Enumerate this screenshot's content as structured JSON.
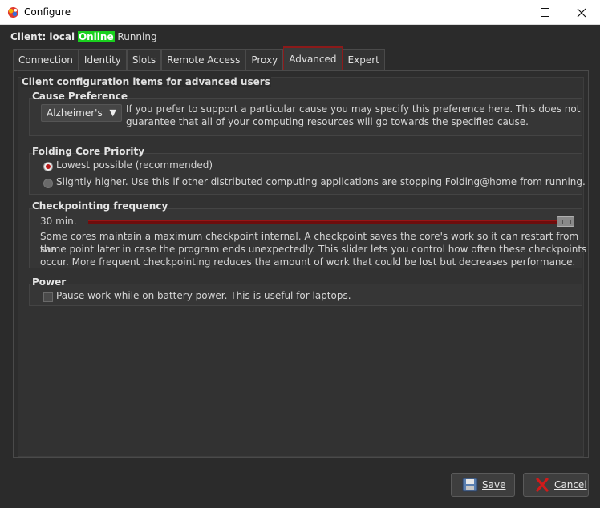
{
  "window": {
    "title": "Configure",
    "icons": {
      "app": "folding-at-home-logo-icon",
      "minimize": "minimize-icon",
      "maximize": "maximize-icon",
      "close": "close-icon"
    }
  },
  "client": {
    "label": "Client: local",
    "status": "Online",
    "state": "Running",
    "status_color": "#19d11e"
  },
  "tabs": [
    {
      "label": "Connection",
      "active": false
    },
    {
      "label": "Identity",
      "active": false
    },
    {
      "label": "Slots",
      "active": false
    },
    {
      "label": "Remote Access",
      "active": false
    },
    {
      "label": "Proxy",
      "active": false
    },
    {
      "label": "Advanced",
      "active": true
    },
    {
      "label": "Expert",
      "active": false
    }
  ],
  "advanced": {
    "heading": "Client configuration items for advanced users",
    "cause": {
      "title": "Cause Preference",
      "selected": "Alzheimer's",
      "description_line1": "If you prefer to support a particular cause you may specify this preference here.  This does not",
      "description_line2": "guarantee that all of your computing resources will go towards the specified cause."
    },
    "priority": {
      "title": "Folding Core Priority",
      "option_low": "Lowest possible (recommended)",
      "option_high": "Slightly higher.  Use this if other distributed computing applications are stopping Folding@home from running.",
      "selected": "low"
    },
    "checkpoint": {
      "title": "Checkpointing frequency",
      "value_label": "30 min.",
      "slider_fraction": 1.0,
      "desc_line1": "Some cores maintain a maximum checkpoint internal.  A checkpoint saves the core's work so it can restart from the",
      "desc_line2": "same point later in case the program ends unexpectedly.  This slider lets you control how often these checkpoints",
      "desc_line3": "occur.  More frequent checkpointing reduces the amount of work that could be lost but decreases performance."
    },
    "power": {
      "title": "Power",
      "checkbox_label": "Pause work while on battery power.  This is useful for laptops.",
      "checked": false
    }
  },
  "buttons": {
    "save": {
      "label": "Save",
      "icon": "floppy-disk-icon"
    },
    "cancel": {
      "label": "Cancel",
      "icon": "red-x-icon"
    }
  },
  "colors": {
    "accent": "#8b1a1a",
    "slider": "#6e0d0d",
    "online": "#19d11e"
  }
}
